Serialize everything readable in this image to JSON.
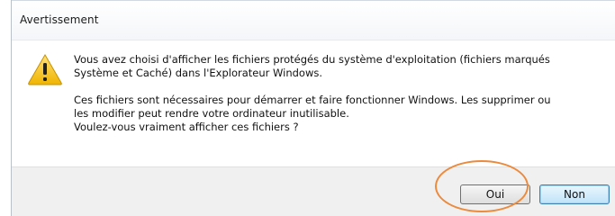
{
  "dialog": {
    "title": "Avertissement",
    "icon": "warning-icon",
    "message_line1": "Vous avez choisi d'afficher les fichiers protégés du système d'exploitation (fichiers marqués",
    "message_line2": "Système et Caché) dans l'Explorateur Windows.",
    "message_line3": "Ces fichiers sont nécessaires pour démarrer et faire fonctionner Windows. Les supprimer ou",
    "message_line4": "les modifier peut rendre votre ordinateur inutilisable.",
    "message_line5": "Voulez-vous vraiment afficher ces fichiers ?"
  },
  "buttons": {
    "yes_label": "Oui",
    "no_label": "Non"
  },
  "colors": {
    "highlight_circle": "#ec8a3d",
    "warning_fill": "#f5c518",
    "default_button_border": "#3c7fb1"
  }
}
